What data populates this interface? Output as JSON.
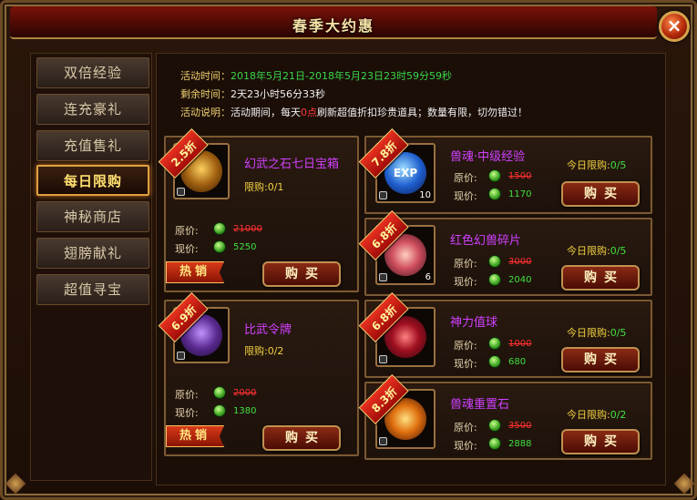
{
  "window": {
    "title": "春季大约惠",
    "close_label": "×"
  },
  "sidebar": {
    "items": [
      {
        "label": "双倍经验",
        "active": false
      },
      {
        "label": "连充豪礼",
        "active": false
      },
      {
        "label": "充值售礼",
        "active": false
      },
      {
        "label": "每日限购",
        "active": true
      },
      {
        "label": "神秘商店",
        "active": false
      },
      {
        "label": "翅膀献礼",
        "active": false
      },
      {
        "label": "超值寻宝",
        "active": false
      }
    ]
  },
  "info": {
    "time_label": "活动时间：",
    "time_value": "2018年5月21日-2018年5月23日23时59分59秒",
    "remain_label": "剩余时间：",
    "remain_value": "2天23小时56分33秒",
    "desc_label": "活动说明：",
    "desc_pre": "活动期间，每天",
    "desc_hl": "0点",
    "desc_post": "刷新超值折扣珍贵道具；数量有限，切勿错过！"
  },
  "labels": {
    "orig_price": "原价:",
    "now_price": "现价:",
    "buy": "购买",
    "hot": "热销"
  },
  "left_items": [
    {
      "name": "幻武之石七日宝箱",
      "discount": "2.5折",
      "limit": "限购:0/1",
      "orig": "21000",
      "price": "5250",
      "hot": true
    },
    {
      "name": "比武令牌",
      "discount": "6.9折",
      "limit": "限购:0/2",
      "orig": "2000",
      "price": "1380",
      "hot": true
    }
  ],
  "right_items": [
    {
      "name": "兽魂·中级经验",
      "discount": "7.8折",
      "qty": "10",
      "orig": "1500",
      "price": "1170",
      "daily_label": "今日限购:",
      "daily_value": "0/5",
      "icon": "exp-orb-icon",
      "icon_text": "EXP"
    },
    {
      "name": "红色幻兽碎片",
      "discount": "6.8折",
      "qty": "6",
      "orig": "3000",
      "price": "2040",
      "daily_label": "今日限购:",
      "daily_value": "0/5",
      "icon": "red-lotus-icon",
      "icon_text": ""
    },
    {
      "name": "神力值球",
      "discount": "6.8折",
      "qty": "",
      "orig": "1000",
      "price": "680",
      "daily_label": "今日限购:",
      "daily_value": "0/5",
      "icon": "power-orb-icon",
      "icon_text": ""
    },
    {
      "name": "兽魂重置石",
      "discount": "8.3折",
      "qty": "",
      "orig": "3500",
      "price": "2888",
      "daily_label": "今日限购:",
      "daily_value": "0/2",
      "icon": "flame-stone-icon",
      "icon_text": ""
    }
  ],
  "colors": {
    "accent_gold": "#e0a040",
    "item_name": "#d040ff",
    "price_new": "#40e040",
    "price_old": "#ff3030"
  }
}
